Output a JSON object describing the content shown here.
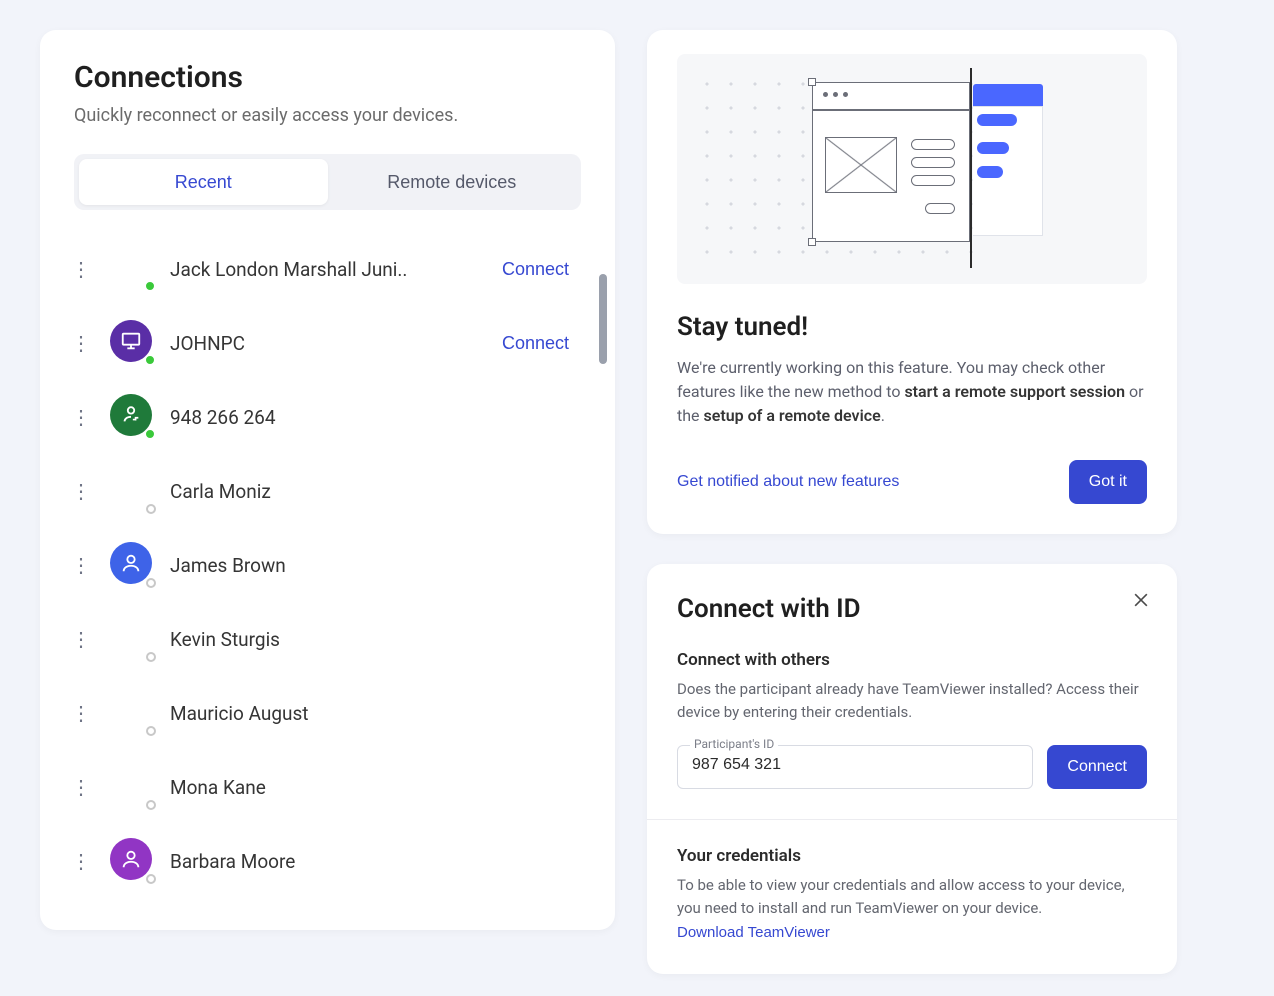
{
  "connections": {
    "title": "Connections",
    "subtitle": "Quickly reconnect or easily access your devices.",
    "tabs": {
      "recent": "Recent",
      "remote": "Remote devices"
    },
    "connect_label": "Connect",
    "items": [
      {
        "name": "Jack London Marshall Juni..",
        "avatar_color": "",
        "avatar_icon": "none",
        "status": "online",
        "show_connect": true
      },
      {
        "name": "JOHNPC",
        "avatar_color": "#5a2ea6",
        "avatar_icon": "monitor",
        "status": "online",
        "show_connect": true
      },
      {
        "name": "948 266 264",
        "avatar_color": "#1f7a3a",
        "avatar_icon": "user-swap",
        "status": "online",
        "show_connect": false
      },
      {
        "name": "Carla Moniz",
        "avatar_color": "",
        "avatar_icon": "none",
        "status": "offline",
        "show_connect": false
      },
      {
        "name": "James Brown",
        "avatar_color": "#3e63e8",
        "avatar_icon": "user",
        "status": "offline",
        "show_connect": false
      },
      {
        "name": "Kevin Sturgis",
        "avatar_color": "",
        "avatar_icon": "none",
        "status": "offline",
        "show_connect": false
      },
      {
        "name": "Mauricio August",
        "avatar_color": "",
        "avatar_icon": "none",
        "status": "offline",
        "show_connect": false
      },
      {
        "name": "Mona Kane",
        "avatar_color": "",
        "avatar_icon": "none",
        "status": "offline",
        "show_connect": false
      },
      {
        "name": "Barbara Moore",
        "avatar_color": "#9135c4",
        "avatar_icon": "user",
        "status": "offline",
        "show_connect": false
      }
    ]
  },
  "stay_tuned": {
    "title": "Stay tuned!",
    "body_prefix": "We're currently working on this feature. You may check other features like the new method to ",
    "body_bold1": "start a remote support session",
    "body_mid": " or the ",
    "body_bold2": "setup of a remote device",
    "body_suffix": ".",
    "notify_link": "Get notified about new features",
    "got_it": "Got it"
  },
  "connect_id": {
    "title": "Connect with ID",
    "section1_title": "Connect with others",
    "section1_desc": "Does the participant already have TeamViewer installed? Access their device by entering their credentials.",
    "field_label": "Participant's ID",
    "field_value": "987 654 321",
    "connect_btn": "Connect",
    "section2_title": "Your credentials",
    "section2_desc": "To be able to view your credentials and allow access to your device, you need to install and run TeamViewer on your device.  ",
    "download_link": "Download TeamViewer"
  }
}
